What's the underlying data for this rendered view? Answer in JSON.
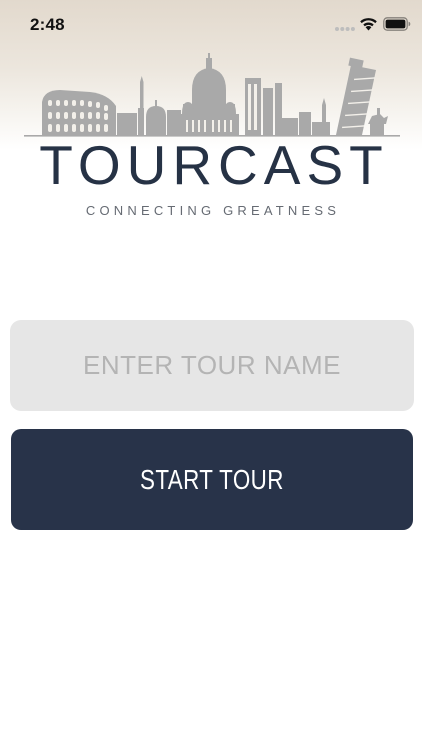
{
  "status_bar": {
    "time": "2:48",
    "icons": [
      "cellular-signal-icon",
      "wifi-icon",
      "battery-icon"
    ]
  },
  "header": {
    "illustration": "city-skyline-illustration"
  },
  "logo": {
    "title": "TOURCAST",
    "tagline": "CONNECTING GREATNESS"
  },
  "tour_form": {
    "name_placeholder": "ENTER TOUR NAME",
    "name_value": "",
    "start_label": "START TOUR"
  },
  "colors": {
    "brand_navy": "#283349",
    "input_background": "#e6e6e6",
    "placeholder_gray": "#b4b4b4",
    "skyline_gray": "#a9a9a9"
  }
}
